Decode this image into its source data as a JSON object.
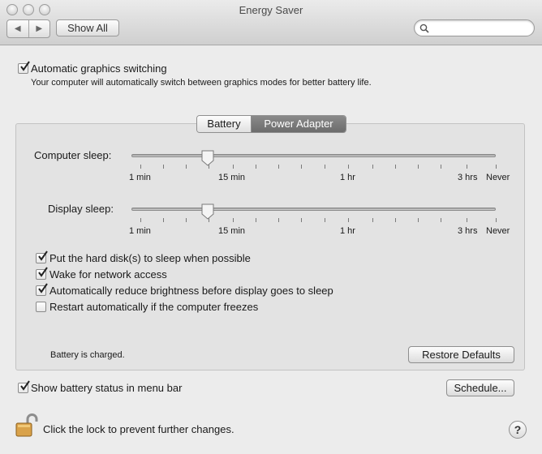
{
  "window": {
    "title": "Energy Saver"
  },
  "toolbar": {
    "show_all_label": "Show All",
    "back_icon": "back-arrow-icon",
    "forward_icon": "forward-arrow-icon",
    "search_placeholder": ""
  },
  "graphics": {
    "checkbox_label": "Automatic graphics switching",
    "checked": true,
    "description": "Your computer will automatically switch between graphics modes for better battery life."
  },
  "tabs": [
    {
      "label": "Battery",
      "selected": false
    },
    {
      "label": "Power Adapter",
      "selected": true
    }
  ],
  "sliders": {
    "tick_labels": [
      "1 min",
      "15 min",
      "1 hr",
      "3 hrs",
      "Never"
    ],
    "computer_sleep": {
      "label": "Computer sleep:",
      "value": "15 min"
    },
    "display_sleep": {
      "label": "Display sleep:",
      "value": "15 min"
    }
  },
  "options": [
    {
      "label": "Put the hard disk(s) to sleep when possible",
      "checked": true
    },
    {
      "label": "Wake for network access",
      "checked": true
    },
    {
      "label": "Automatically reduce brightness before display goes to sleep",
      "checked": true
    },
    {
      "label": "Restart automatically if the computer freezes",
      "checked": false
    }
  ],
  "status": {
    "battery_text": "Battery is charged."
  },
  "buttons": {
    "restore_defaults": "Restore Defaults",
    "schedule": "Schedule...",
    "help": "?"
  },
  "menubar_option": {
    "label": "Show battery status in menu bar",
    "checked": true
  },
  "lock": {
    "text": "Click the lock to prevent further changes."
  }
}
